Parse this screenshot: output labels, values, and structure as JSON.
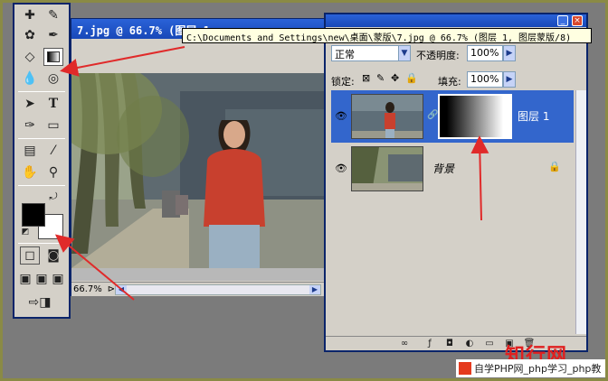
{
  "document": {
    "title": "7.jpg @ 66.7% (图层 1, 图层蒙版/8)",
    "title_short": "7.jpg @ 66.7% (图层 1,",
    "zoom": "66.7%",
    "path_tooltip": "C:\\Documents and Settings\\new\\桌面\\蒙版\\7.jpg @ 66.7% (图层 1, 图层蒙版/8)"
  },
  "layers_panel": {
    "blend_mode": "正常",
    "opacity_label": "不透明度:",
    "opacity_value": "100%",
    "lock_label": "锁定:",
    "fill_label": "填充:",
    "fill_value": "100%",
    "layers": [
      {
        "name": "图层 1",
        "selected": true,
        "has_mask": true
      },
      {
        "name": "背景",
        "selected": false,
        "locked": true
      }
    ]
  },
  "watermark": {
    "logo_text": "知行网",
    "bar_text": "自学PHP网_php学习_php教"
  },
  "colors": {
    "title_bar": "#1848b8",
    "selection": "#3366cc",
    "foreground": "#000000",
    "background_swatch": "#ffffff",
    "arrow": "#e02a2a"
  }
}
